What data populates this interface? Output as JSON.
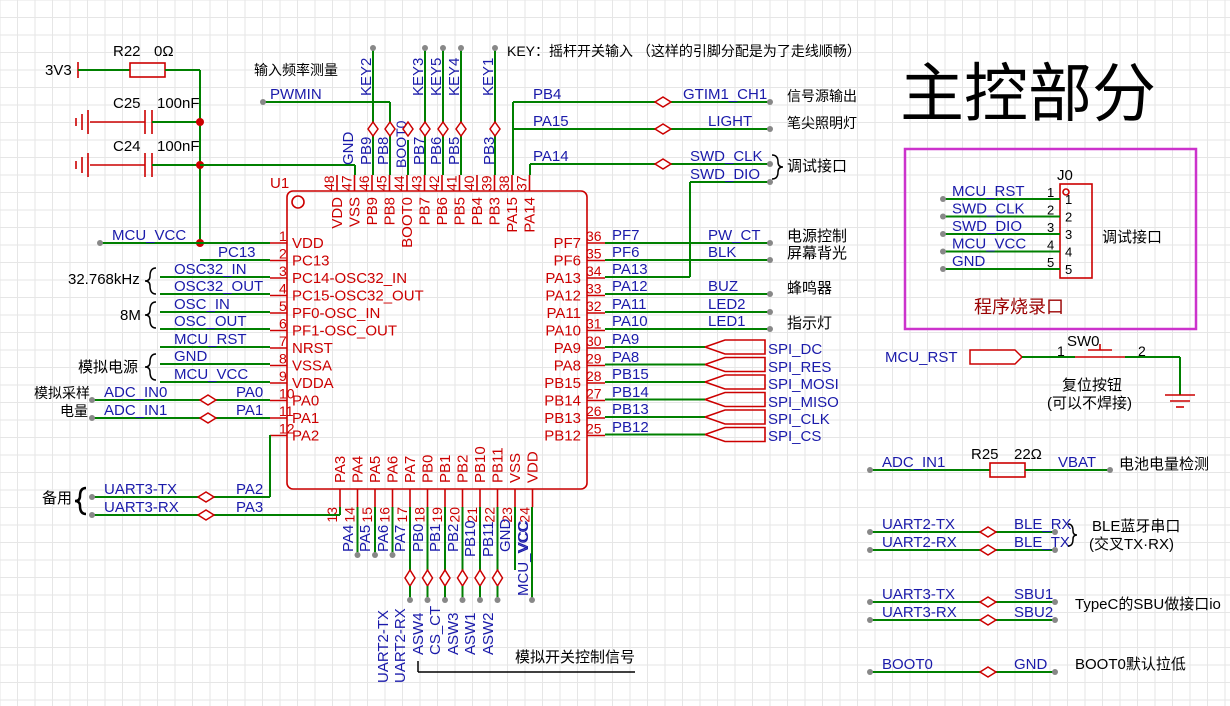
{
  "title": "主控部分",
  "ic": {
    "ref": "U1",
    "left_pins": [
      {
        "num": "1",
        "name": "VDD"
      },
      {
        "num": "2",
        "name": "PC13"
      },
      {
        "num": "3",
        "name": "PC14-OSC32_IN"
      },
      {
        "num": "4",
        "name": "PC15-OSC32_OUT"
      },
      {
        "num": "5",
        "name": "PF0-OSC_IN"
      },
      {
        "num": "6",
        "name": "PF1-OSC_OUT"
      },
      {
        "num": "7",
        "name": "NRST"
      },
      {
        "num": "8",
        "name": "VSSA"
      },
      {
        "num": "9",
        "name": "VDDA"
      },
      {
        "num": "10",
        "name": "PA0"
      },
      {
        "num": "11",
        "name": "PA1"
      },
      {
        "num": "12",
        "name": "PA2"
      }
    ],
    "right_pins": [
      {
        "num": "36",
        "name": "PF7"
      },
      {
        "num": "35",
        "name": "PF6"
      },
      {
        "num": "34",
        "name": "PA13"
      },
      {
        "num": "33",
        "name": "PA12"
      },
      {
        "num": "32",
        "name": "PA11"
      },
      {
        "num": "31",
        "name": "PA10"
      },
      {
        "num": "30",
        "name": "PA9"
      },
      {
        "num": "29",
        "name": "PA8"
      },
      {
        "num": "28",
        "name": "PB15"
      },
      {
        "num": "27",
        "name": "PB14"
      },
      {
        "num": "26",
        "name": "PB13"
      },
      {
        "num": "25",
        "name": "PB12"
      }
    ],
    "top_pins": [
      {
        "num": "48",
        "name": "VDD"
      },
      {
        "num": "47",
        "name": "VSS"
      },
      {
        "num": "46",
        "name": "PB9"
      },
      {
        "num": "45",
        "name": "PB8"
      },
      {
        "num": "44",
        "name": "BOOT0"
      },
      {
        "num": "43",
        "name": "PB7"
      },
      {
        "num": "42",
        "name": "PB6"
      },
      {
        "num": "41",
        "name": "PB5"
      },
      {
        "num": "40",
        "name": "PB4"
      },
      {
        "num": "39",
        "name": "PB3"
      },
      {
        "num": "38",
        "name": "PA15"
      },
      {
        "num": "37",
        "name": "PA14"
      }
    ],
    "bottom_pins": [
      {
        "num": "13",
        "name": "PA3"
      },
      {
        "num": "14",
        "name": "PA4"
      },
      {
        "num": "15",
        "name": "PA5"
      },
      {
        "num": "16",
        "name": "PA6"
      },
      {
        "num": "17",
        "name": "PA7"
      },
      {
        "num": "18",
        "name": "PB0"
      },
      {
        "num": "19",
        "name": "PB1"
      },
      {
        "num": "20",
        "name": "PB2"
      },
      {
        "num": "21",
        "name": "PB10"
      },
      {
        "num": "22",
        "name": "PB11"
      },
      {
        "num": "23",
        "name": "VSS"
      },
      {
        "num": "24",
        "name": "VDD"
      }
    ]
  },
  "left_nets": {
    "l1": "MCU_VCC",
    "l2": "PC13",
    "l3": "OSC32_IN",
    "l4": "OSC32_OUT",
    "l5": "OSC_IN",
    "l6": "OSC_OUT",
    "l7": "MCU_RST",
    "l8": "GND",
    "l9": "MCU_VCC",
    "l10a": "ADC_IN0",
    "l10b": "PA0",
    "l11a": "ADC_IN1",
    "l11b": "PA1",
    "u3tx": "UART3-TX",
    "u3txb": "PA2",
    "u3rx": "UART3-RX",
    "u3rxb": "PA3"
  },
  "left_notes": {
    "xtal32": "32.768kHz",
    "xtal8": "8M",
    "analog_pwr": "模拟电源",
    "adc1": "模拟采样",
    "adc2": "电量",
    "spare": "备用"
  },
  "top_net_labels": {
    "gnd": "GND",
    "pb9": "PB9",
    "pb8": "PB8",
    "boot0": "BOOT0",
    "pb7": "PB7",
    "pb6": "PB6",
    "pb5": "PB5",
    "pb3": "PB3",
    "key2": "KEY2",
    "key3": "KEY3",
    "key5": "KEY5",
    "key4": "KEY4",
    "key1": "KEY1"
  },
  "top_notes": {
    "key": "KEY：摇杆开关输入 （这样的引脚分配是为了走线顺畅）",
    "freq": "输入频率测量",
    "pwmin": "PWMIN"
  },
  "power": {
    "r22": "R22",
    "r22v": "0Ω",
    "v3": "3V3",
    "c25": "C25",
    "c25v": "100nF",
    "c24": "C24",
    "c24v": "100nF",
    "mcuvcc": "MCU_VCC"
  },
  "right_nets": {
    "pb4": "PB4",
    "gtim": "GTIM1_CH1",
    "sig": "信号源输出",
    "pa15": "PA15",
    "light": "LIGHT",
    "pen": "笔尖照明灯",
    "pa14": "PA14",
    "swdclk": "SWD_CLK",
    "swddio": "SWD_DIO",
    "dbg": "调试接口",
    "pf7": "PF7",
    "pwct": "PW_CT",
    "pwr": "电源控制",
    "pf6": "PF6",
    "blk": "BLK",
    "bl": "屏幕背光",
    "pa13": "PA13",
    "pa12": "PA12",
    "buz": "BUZ",
    "buzn": "蜂鸣器",
    "pa11": "PA11",
    "led2": "LED2",
    "pa10": "PA10",
    "led1": "LED1",
    "ledn": "指示灯",
    "pa9": "PA9",
    "pa8": "PA8",
    "pb15": "PB15",
    "pb14": "PB14",
    "pb13": "PB13",
    "pb12": "PB12",
    "spidc": "SPI_DC",
    "spires": "SPI_RES",
    "spimosi": "SPI_MOSI",
    "spimiso": "SPI_MISO",
    "spiclk": "SPI_CLK",
    "spics": "SPI_CS"
  },
  "bottom_nets": {
    "pa4": "PA4",
    "pa5": "PA5",
    "pa6": "PA6",
    "pa7": "PA7",
    "pb0": "PB0",
    "pb1": "PB1",
    "pb2": "PB2",
    "pb10": "PB10",
    "pb11": "PB11",
    "gnd": "GND",
    "vcc": "VCC",
    "mcuvcc": "MCU_VCC",
    "u2tx": "UART2-TX",
    "u2rx": "UART2-RX",
    "asw4": "ASW4",
    "csct": "CS_CT",
    "asw3": "ASW3",
    "asw1": "ASW1",
    "asw2": "ASW2",
    "note": "模拟开关控制信号"
  },
  "debug_box": {
    "ref": "J0",
    "nets": [
      "MCU_RST",
      "SWD_CLK",
      "SWD_DIO",
      "MCU_VCC",
      "GND"
    ],
    "pins": [
      "1",
      "2",
      "3",
      "4",
      "5"
    ],
    "label": "调试接口",
    "caption": "程序烧录口"
  },
  "reset": {
    "net": "MCU_RST",
    "ref": "SW0",
    "p1": "1",
    "p2": "2",
    "note1": "复位按钮",
    "note2": "(可以不焊接)"
  },
  "battery": {
    "net": "ADC_IN1",
    "ref": "R25",
    "val": "22Ω",
    "vbat": "VBAT",
    "note": "电池电量检测"
  },
  "ble": {
    "a": "UART2-TX",
    "b": "UART2-RX",
    "c": "BLE_RX",
    "d": "BLE_TX",
    "note1": "BLE蓝牙串口",
    "note2": "(交叉TX·RX)"
  },
  "sbu": {
    "a": "UART3-TX",
    "b": "UART3-RX",
    "c": "SBU1",
    "d": "SBU2",
    "note": "TypeC的SBU做接口io"
  },
  "boot": {
    "a": "BOOT0",
    "b": "GND",
    "note": "BOOT0默认拉低"
  }
}
